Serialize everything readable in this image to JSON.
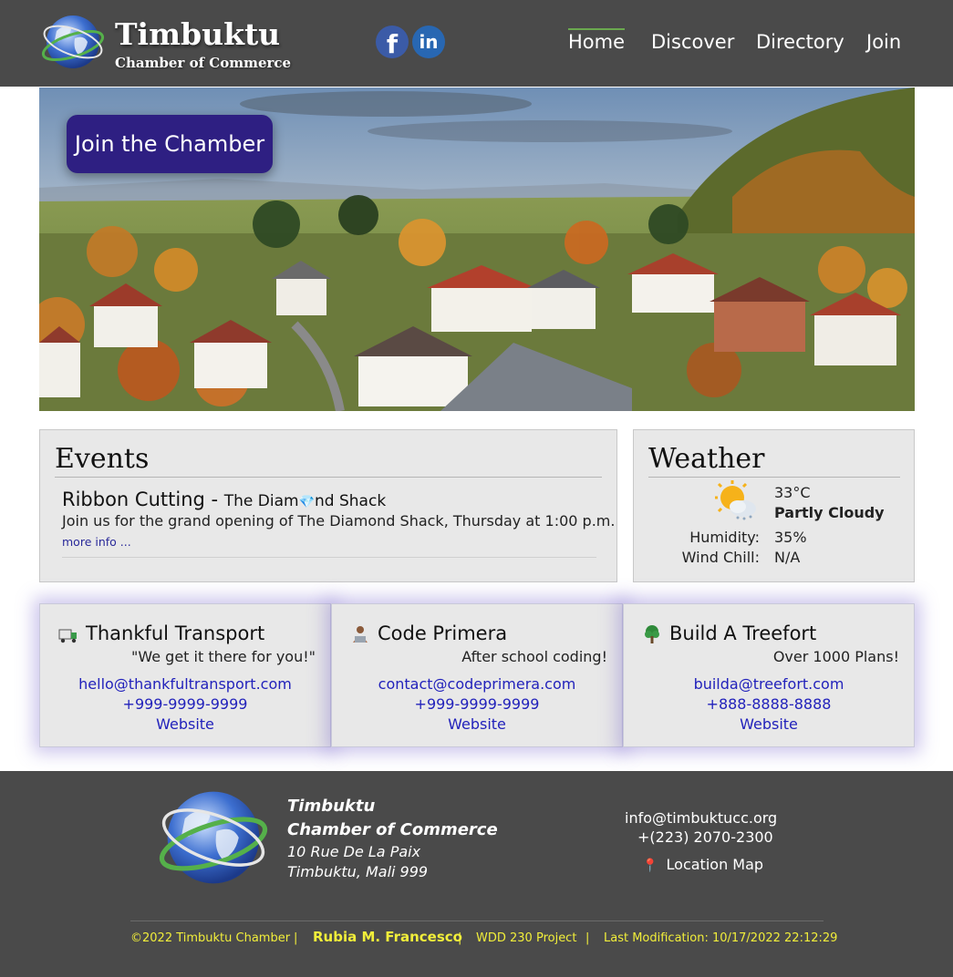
{
  "header": {
    "title": "Timbuktu",
    "subtitle": "Chamber of Commerce",
    "nav": [
      "Home",
      "Discover",
      "Directory",
      "Join"
    ],
    "active_nav": "Home",
    "social": [
      "facebook-icon",
      "linkedin-icon"
    ]
  },
  "hero": {
    "button_label": "Join the Chamber"
  },
  "events": {
    "heading": "Events",
    "item_title": "Ribbon Cutting - ",
    "item_shop_before": "The Diam",
    "item_shop_after": "nd Shack",
    "item_desc": "Join us for the grand opening of The Diamond Shack, Thursday at 1:00 p.m.",
    "more_link": "more info ..."
  },
  "weather": {
    "heading": "Weather",
    "temp": "33°C",
    "condition": "Partly Cloudy",
    "humidity_label": "Humidity:",
    "humidity_value": "35%",
    "windchill_label": "Wind Chill:",
    "windchill_value": "N/A",
    "icon": "partly-cloudy-icon"
  },
  "spotlights": [
    {
      "name": "Thankful Transport",
      "icon": "truck-icon",
      "tagline": "\"We get it there for you!\"",
      "email": "hello@thankfultransport.com",
      "phone": "+999-9999-9999",
      "website": "Website"
    },
    {
      "name": "Code Primera",
      "icon": "coder-icon",
      "tagline": "After school coding!",
      "email": "contact@codeprimera.com",
      "phone": "+999-9999-9999",
      "website": "Website"
    },
    {
      "name": "Build A Treefort",
      "icon": "tree-icon",
      "tagline": "Over 1000 Plans!",
      "email": "builda@treefort.com",
      "phone": "+888-8888-8888",
      "website": "Website"
    }
  ],
  "footer": {
    "name1": "Timbuktu",
    "name2": "Chamber of Commerce",
    "address1": "10 Rue De La Paix",
    "address2": "Timbuktu, Mali 999",
    "email": "info@timbuktucc.org",
    "phone": "+(223) 2070-2300",
    "map_link": "Location Map",
    "copyright": "©2022 Timbuktu Chamber",
    "author": "Rubia M. Francesco",
    "project": "WDD 230 Project",
    "last_mod": "Last Modification: 10/17/2022 22:12:29",
    "separator": "|"
  }
}
